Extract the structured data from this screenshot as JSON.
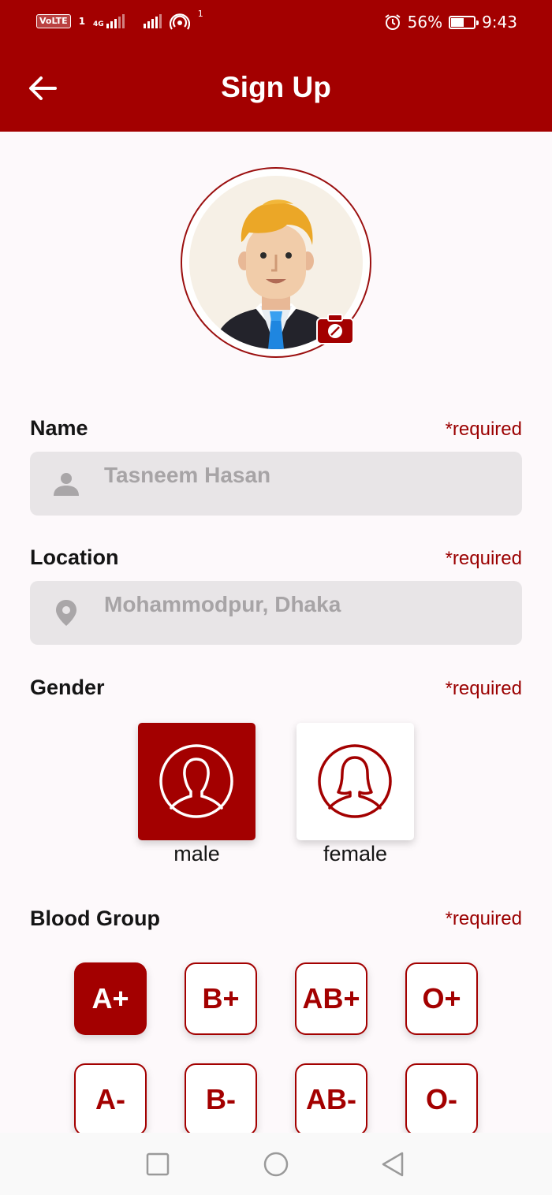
{
  "status_bar": {
    "volte": "VoLTE",
    "sim_slot": "1",
    "network": "4G",
    "hotspot_count": "1",
    "battery_percent": "56%",
    "battery_level": 0.56,
    "time": "9:43"
  },
  "header": {
    "title": "Sign Up",
    "background": "#a30000"
  },
  "avatar": {
    "icon": "user-avatar",
    "camera_icon": "camera-icon"
  },
  "form": {
    "name": {
      "label": "Name",
      "required": "*required",
      "placeholder": "Tasneem Hasan",
      "icon": "person-icon"
    },
    "location": {
      "label": "Location",
      "required": "*required",
      "placeholder": "Mohammodpur, Dhaka",
      "icon": "location-pin-icon"
    },
    "gender": {
      "label": "Gender",
      "required": "*required",
      "options": [
        {
          "label": "male",
          "selected": true,
          "icon": "male-icon"
        },
        {
          "label": "female",
          "selected": false,
          "icon": "female-icon"
        }
      ]
    },
    "blood_group": {
      "label": "Blood Group",
      "required": "*required",
      "options": [
        "A+",
        "B+",
        "AB+",
        "O+",
        "A-",
        "B-",
        "AB-",
        "O-"
      ],
      "selected": "A+"
    }
  },
  "accent_color": "#a30000"
}
